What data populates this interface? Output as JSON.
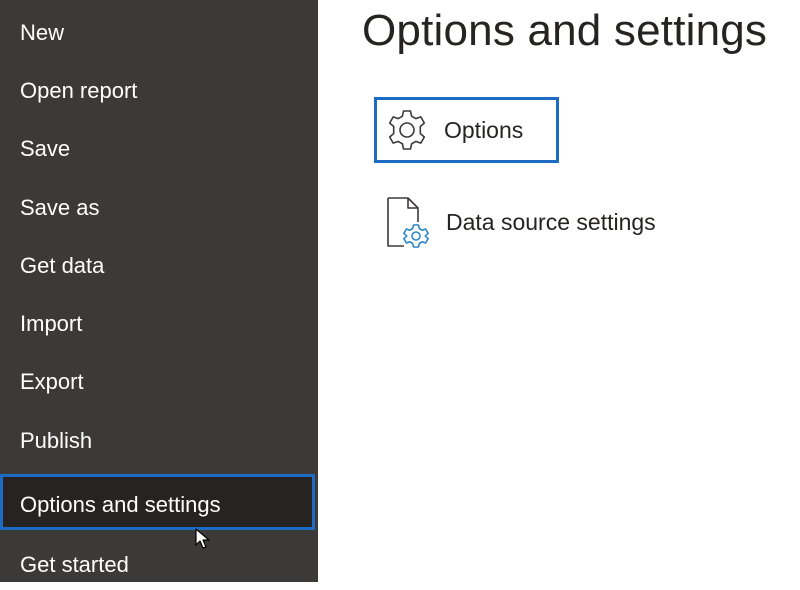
{
  "sidebar": {
    "items": [
      {
        "label": "New"
      },
      {
        "label": "Open report"
      },
      {
        "label": "Save"
      },
      {
        "label": "Save as"
      },
      {
        "label": "Get data"
      },
      {
        "label": "Import"
      },
      {
        "label": "Export"
      },
      {
        "label": "Publish"
      },
      {
        "label": "Options and settings",
        "selected": true
      },
      {
        "label": "Get started"
      }
    ]
  },
  "main": {
    "title": "Options and settings",
    "options": [
      {
        "label": "Options",
        "icon": "gear-icon"
      },
      {
        "label": "Data source settings",
        "icon": "document-gear-icon"
      }
    ]
  },
  "colors": {
    "sidebar_bg": "#3b3a39",
    "selected_bg": "#252423",
    "accent": "#1e6bc4",
    "icon_blue": "#2e86c9"
  }
}
